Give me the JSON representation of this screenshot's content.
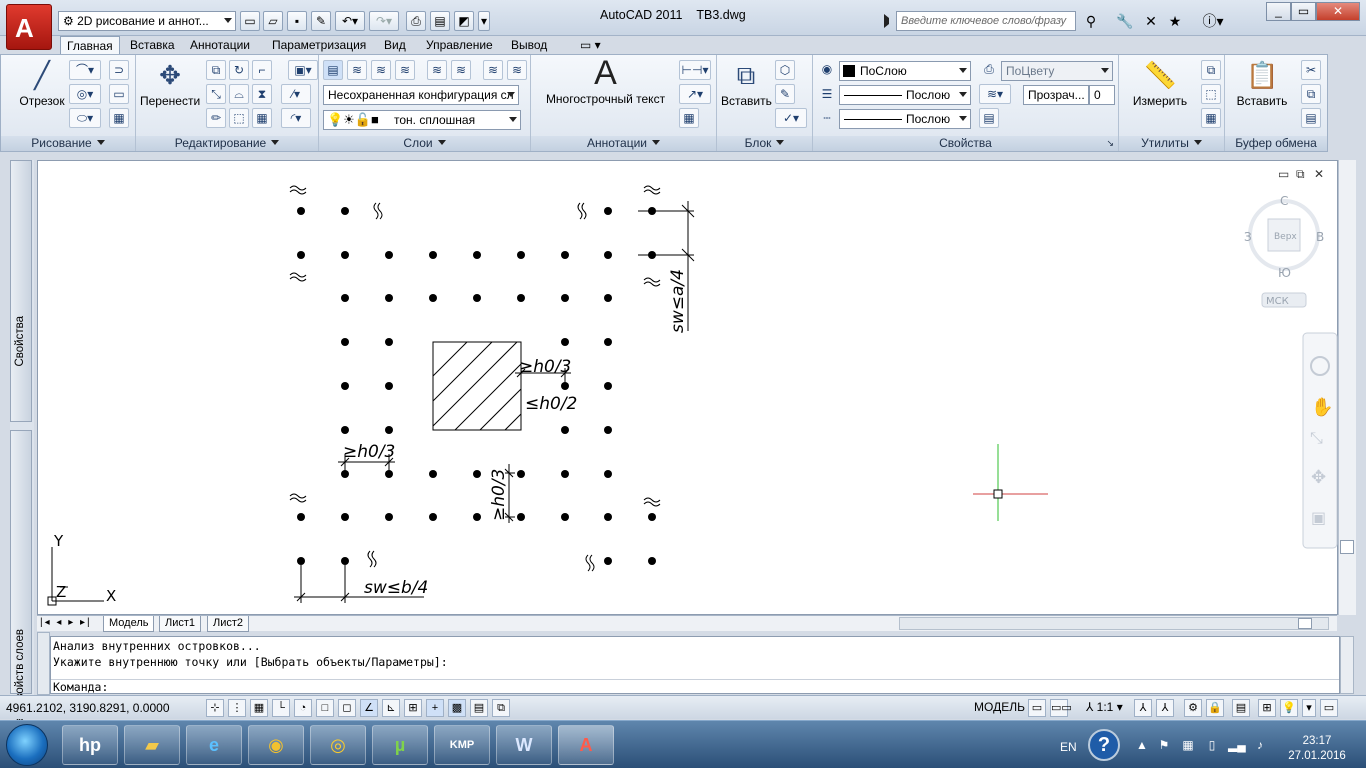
{
  "app": {
    "title": "AutoCAD 2011",
    "filename": "TB3.dwg",
    "workspace": "2D рисование и аннот...",
    "search_placeholder": "Введите ключевое слово/фразу",
    "logo_letter": "A"
  },
  "ribbon_tabs": [
    "Главная",
    "Вставка",
    "Аннотации",
    "Параметризация",
    "Вид",
    "Управление",
    "Вывод"
  ],
  "ribbon": {
    "draw": {
      "title": "Рисование",
      "line": "Отрезок"
    },
    "modify": {
      "title": "Редактирование",
      "move": "Перенести"
    },
    "layers": {
      "title": "Слои",
      "layer_state": "Несохраненная конфигурация сл",
      "current_layer": "тон. сплошная"
    },
    "annotation": {
      "title": "Аннотации",
      "mtext": "Многострочный текст",
      "mtext_glyph": "A"
    },
    "block": {
      "title": "Блок",
      "insert": "Вставить"
    },
    "properties": {
      "title": "Свойства",
      "color": "ПоСлою",
      "linetype": "Послою",
      "lineweight": "Послою",
      "plotstyle": "ПоЦвету",
      "transparency_label": "Прозрач...",
      "transparency_value": "0"
    },
    "utilities": {
      "title": "Утилиты",
      "measure": "Измерить"
    },
    "clipboard": {
      "title": "Буфер обмена",
      "paste": "Вставить"
    }
  },
  "palettes": {
    "properties": "Свойства",
    "layer_props": "Диспетчер свойств слоев"
  },
  "viewcube": {
    "north": "С",
    "south": "Ю",
    "west": "З",
    "east": "В",
    "top": "Верх",
    "ucs": "МСК"
  },
  "drawing": {
    "label_sw_a": "sw≤a/4",
    "label_h0_3_top": "≥h0/3",
    "label_h0_2": "≤h0/2",
    "label_h0_3_left": "≥h0/3",
    "label_h0_3_vert": "≥h0/3",
    "label_sw_b": "sw≤b/4",
    "axis_x": "X",
    "axis_y": "Y",
    "axis_z": "Z"
  },
  "layout_tabs": [
    "Модель",
    "Лист1",
    "Лист2"
  ],
  "command": {
    "line1": "Анализ внутренних островков...",
    "line2": "Укажите внутреннюю точку или [Выбрать объекты/Параметры]:",
    "prompt": "Команда:"
  },
  "status": {
    "coords": "4961.2102, 3190.8291, 0.0000",
    "mode": "МОДЕЛЬ",
    "scale": "1:1"
  },
  "taskbar": {
    "lang": "EN",
    "time": "23:17",
    "date": "27.01.2016",
    "apps": [
      "hp",
      "folder",
      "ie",
      "media",
      "chrome",
      "utorrent",
      "kmp",
      "word",
      "autocad"
    ]
  },
  "colors": {
    "accent_red": "#c8241a",
    "ribbon_bg": "#dde5ef",
    "crosshair_green": "#2fbf2f",
    "crosshair_red": "#d04040"
  }
}
